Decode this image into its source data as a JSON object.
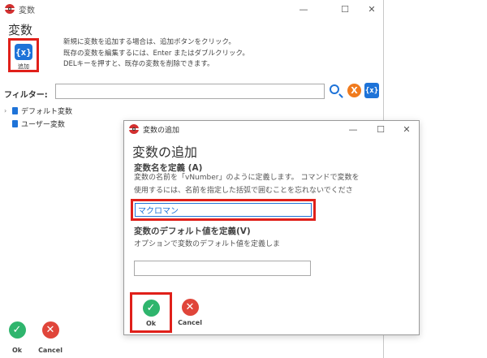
{
  "main_window": {
    "title": "変数",
    "controls": {
      "minimize": "—",
      "maximize": "☐",
      "close": "✕"
    },
    "heading": "変数",
    "add_button": {
      "icon_text": "{x}",
      "label": "追加"
    },
    "description": [
      "新規に変数を追加する場合は、追加ボタンをクリック。",
      "既存の変数を編集するには、Enter またはダブルクリック。",
      "DELキーを押すと、既存の変数を削除できます。"
    ],
    "filter": {
      "label": "フィルター:",
      "value": "",
      "var_icon_text": "{x}",
      "clear_text": "X"
    },
    "tree": [
      {
        "arrow": "›",
        "label": "デフォルト変数"
      },
      {
        "arrow": "",
        "label": "ユーザー変数"
      }
    ],
    "footer": {
      "ok_label": "Ok",
      "cancel_label": "Cancel",
      "ok_glyph": "✓",
      "cancel_glyph": "✕"
    }
  },
  "dialog": {
    "title": "変数の追加",
    "controls": {
      "minimize": "—",
      "maximize": "☐",
      "close": "✕"
    },
    "heading": "変数の追加",
    "name_section": {
      "label": "変数名を定義 (A)",
      "description": [
        "変数の名前を「vNumber」のように定義します。 コマンドで変数を",
        "使用するには、名前を指定した括弧で囲むことを忘れないでくださ"
      ],
      "value": "マクロマン"
    },
    "default_section": {
      "label": "変数のデフォルト値を定義(V)",
      "description": "オプションで変数のデフォルト値を定義しま",
      "value": ""
    },
    "footer": {
      "ok_label": "Ok",
      "cancel_label": "Cancel",
      "ok_glyph": "✓",
      "cancel_glyph": "✕"
    }
  },
  "colors": {
    "highlight": "#e0201a",
    "accent": "#1e73d8",
    "ok": "#2fb56d",
    "cancel": "#e0453a",
    "clear": "#f07b1e"
  }
}
